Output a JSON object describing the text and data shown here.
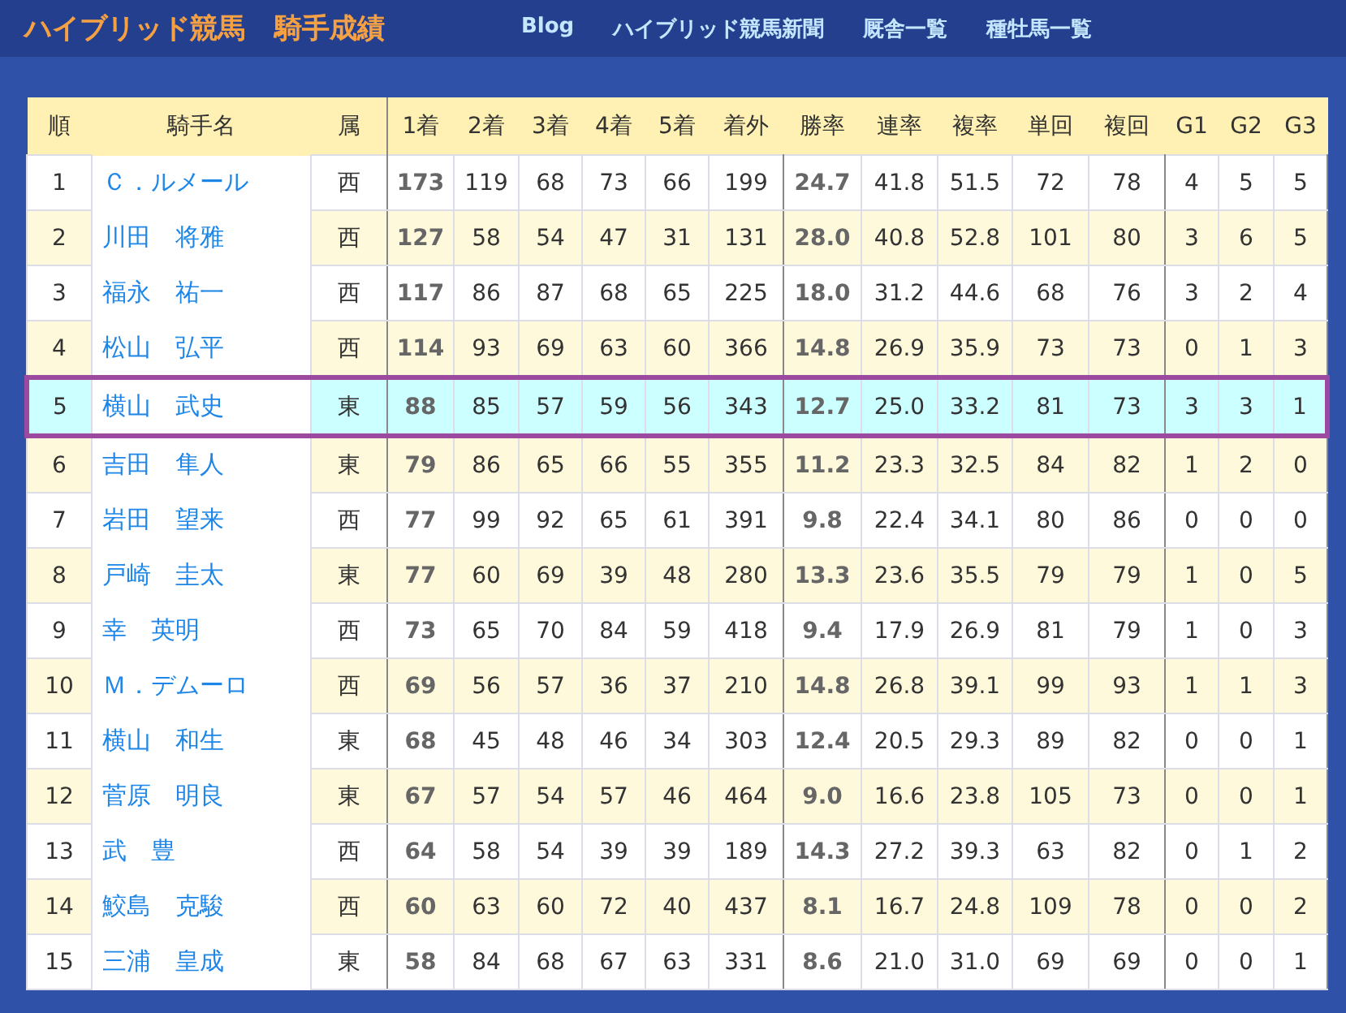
{
  "header": {
    "site_title": "ハイブリッド競馬",
    "page_title": "騎手成績",
    "nav": [
      "Blog",
      "ハイブリッド競馬新聞",
      "厩舎一覧",
      "種牡馬一覧"
    ]
  },
  "table": {
    "columns": [
      "順",
      "騎手名",
      "属",
      "1着",
      "2着",
      "3着",
      "4着",
      "5着",
      "着外",
      "勝率",
      "連率",
      "複率",
      "単回",
      "複回",
      "G1",
      "G2",
      "G3"
    ],
    "rows": [
      {
        "rank": "1",
        "name": "Ｃ．ルメール",
        "affiliation": "西",
        "values": [
          "173",
          "119",
          "68",
          "73",
          "66",
          "199",
          "24.7",
          "41.8",
          "51.5",
          "72",
          "78",
          "4",
          "5",
          "5"
        ],
        "selected": false
      },
      {
        "rank": "2",
        "name": "川田　将雅",
        "affiliation": "西",
        "values": [
          "127",
          "58",
          "54",
          "47",
          "31",
          "131",
          "28.0",
          "40.8",
          "52.8",
          "101",
          "80",
          "3",
          "6",
          "5"
        ],
        "selected": false
      },
      {
        "rank": "3",
        "name": "福永　祐一",
        "affiliation": "西",
        "values": [
          "117",
          "86",
          "87",
          "68",
          "65",
          "225",
          "18.0",
          "31.2",
          "44.6",
          "68",
          "76",
          "3",
          "2",
          "4"
        ],
        "selected": false
      },
      {
        "rank": "4",
        "name": "松山　弘平",
        "affiliation": "西",
        "values": [
          "114",
          "93",
          "69",
          "63",
          "60",
          "366",
          "14.8",
          "26.9",
          "35.9",
          "73",
          "73",
          "0",
          "1",
          "3"
        ],
        "selected": false
      },
      {
        "rank": "5",
        "name": "横山　武史",
        "affiliation": "東",
        "values": [
          "88",
          "85",
          "57",
          "59",
          "56",
          "343",
          "12.7",
          "25.0",
          "33.2",
          "81",
          "73",
          "3",
          "3",
          "1"
        ],
        "selected": true
      },
      {
        "rank": "6",
        "name": "吉田　隼人",
        "affiliation": "東",
        "values": [
          "79",
          "86",
          "65",
          "66",
          "55",
          "355",
          "11.2",
          "23.3",
          "32.5",
          "84",
          "82",
          "1",
          "2",
          "0"
        ],
        "selected": false
      },
      {
        "rank": "7",
        "name": "岩田　望来",
        "affiliation": "西",
        "values": [
          "77",
          "99",
          "92",
          "65",
          "61",
          "391",
          "9.8",
          "22.4",
          "34.1",
          "80",
          "86",
          "0",
          "0",
          "0"
        ],
        "selected": false
      },
      {
        "rank": "8",
        "name": "戸崎　圭太",
        "affiliation": "東",
        "values": [
          "77",
          "60",
          "69",
          "39",
          "48",
          "280",
          "13.3",
          "23.6",
          "35.5",
          "79",
          "79",
          "1",
          "0",
          "5"
        ],
        "selected": false
      },
      {
        "rank": "9",
        "name": "幸　英明",
        "affiliation": "西",
        "values": [
          "73",
          "65",
          "70",
          "84",
          "59",
          "418",
          "9.4",
          "17.9",
          "26.9",
          "81",
          "79",
          "1",
          "0",
          "3"
        ],
        "selected": false
      },
      {
        "rank": "10",
        "name": "Ｍ．デムーロ",
        "affiliation": "西",
        "values": [
          "69",
          "56",
          "57",
          "36",
          "37",
          "210",
          "14.8",
          "26.8",
          "39.1",
          "99",
          "93",
          "1",
          "1",
          "3"
        ],
        "selected": false
      },
      {
        "rank": "11",
        "name": "横山　和生",
        "affiliation": "東",
        "values": [
          "68",
          "45",
          "48",
          "46",
          "34",
          "303",
          "12.4",
          "20.5",
          "29.3",
          "89",
          "82",
          "0",
          "0",
          "1"
        ],
        "selected": false
      },
      {
        "rank": "12",
        "name": "菅原　明良",
        "affiliation": "東",
        "values": [
          "67",
          "57",
          "54",
          "57",
          "46",
          "464",
          "9.0",
          "16.6",
          "23.8",
          "105",
          "73",
          "0",
          "0",
          "1"
        ],
        "selected": false
      },
      {
        "rank": "13",
        "name": "武　豊",
        "affiliation": "西",
        "values": [
          "64",
          "58",
          "54",
          "39",
          "39",
          "189",
          "14.3",
          "27.2",
          "39.3",
          "63",
          "82",
          "0",
          "1",
          "2"
        ],
        "selected": false
      },
      {
        "rank": "14",
        "name": "鮫島　克駿",
        "affiliation": "西",
        "values": [
          "60",
          "63",
          "60",
          "72",
          "40",
          "437",
          "8.1",
          "16.7",
          "24.8",
          "109",
          "78",
          "0",
          "0",
          "2"
        ],
        "selected": false
      },
      {
        "rank": "15",
        "name": "三浦　皇成",
        "affiliation": "東",
        "values": [
          "58",
          "84",
          "68",
          "67",
          "63",
          "331",
          "8.6",
          "21.0",
          "31.0",
          "69",
          "69",
          "0",
          "0",
          "1"
        ],
        "selected": false
      }
    ]
  }
}
